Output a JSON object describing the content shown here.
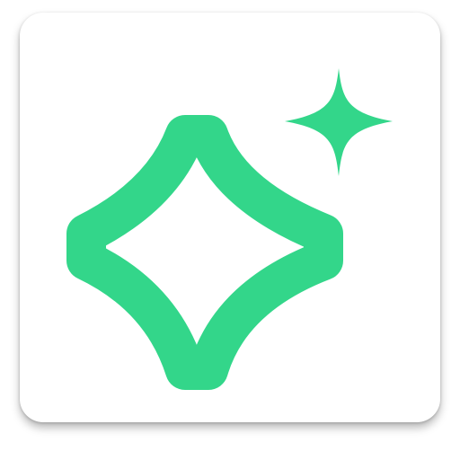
{
  "app_icon": {
    "name": "sparkle-app-icon",
    "accent_color": "#33D68A",
    "tile_color": "#FFFFFF",
    "icons": [
      "sparkle-outline-icon",
      "sparkle-small-icon"
    ]
  }
}
